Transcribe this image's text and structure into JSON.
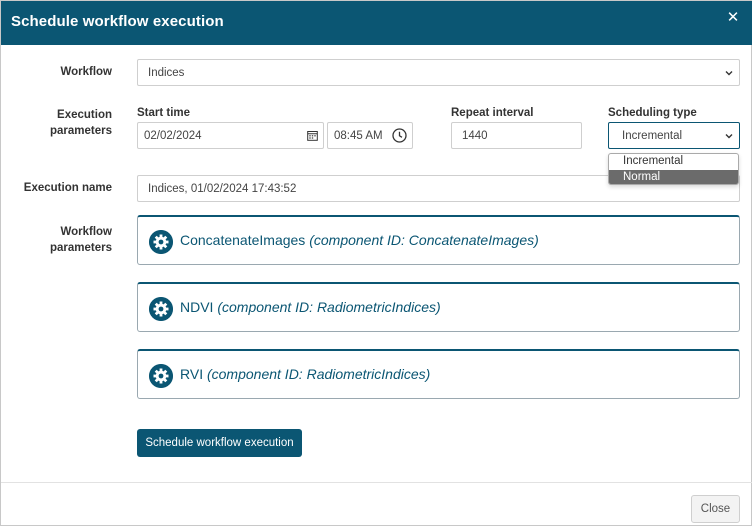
{
  "modal": {
    "title": "Schedule workflow execution",
    "close_icon": "close-icon"
  },
  "workflow": {
    "label": "Workflow",
    "value": "Indices"
  },
  "execution_parameters": {
    "label_line1": "Execution",
    "label_line2": "parameters",
    "start_time": {
      "label": "Start time",
      "date": "02/02/2024",
      "time": "08:45 AM"
    },
    "repeat_interval": {
      "label": "Repeat interval",
      "value": "1440"
    },
    "scheduling_type": {
      "label": "Scheduling type",
      "value": "Incremental",
      "options": [
        "Incremental",
        "Normal"
      ],
      "highlighted": "Normal"
    }
  },
  "execution_name": {
    "label": "Execution name",
    "value": "Indices, 01/02/2024 17:43:52"
  },
  "workflow_parameters": {
    "label_line1": "Workflow",
    "label_line2": "parameters",
    "components": [
      {
        "name": "ConcatenateImages",
        "id_text": "(component ID: ConcatenateImages)"
      },
      {
        "name": "NDVI",
        "id_text": "(component ID: RadiometricIndices)"
      },
      {
        "name": "RVI",
        "id_text": "(component ID: RadiometricIndices)"
      }
    ]
  },
  "actions": {
    "schedule_label": "Schedule workflow execution",
    "close_label": "Close"
  },
  "colors": {
    "primary": "#0b5673",
    "highlight": "#6b6b6b"
  }
}
